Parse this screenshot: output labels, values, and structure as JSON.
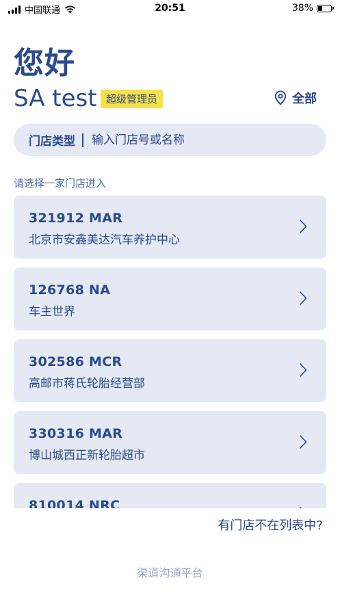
{
  "status_bar": {
    "carrier": "中国联通",
    "time": "20:51",
    "battery_text": "38%",
    "battery_level": 0.38
  },
  "greeting": "您好",
  "user": {
    "name": "SA test",
    "role": "超级管理员"
  },
  "location_filter": {
    "icon": "location-pin-icon",
    "label": "全部"
  },
  "search": {
    "type_label": "门店类型",
    "placeholder": "输入门店号或名称"
  },
  "hint": "请选择一家门店进入",
  "stores": [
    {
      "code": "321912 MAR",
      "name": "北京市安鑫美达汽车养护中心"
    },
    {
      "code": "126768 NA",
      "name": "车主世界"
    },
    {
      "code": "302586 MCR",
      "name": "高邮市蒋氏轮胎经营部"
    },
    {
      "code": "330316 MAR",
      "name": "博山城西正新轮胎超市"
    },
    {
      "code": "810014 NRC",
      "name": ""
    }
  ],
  "missing_store_link": "有门店不在列表中?",
  "footer": "渠道沟通平台",
  "colors": {
    "primary": "#2b4a8c",
    "card_bg": "#e4e9f3",
    "badge_bg": "#f7e04a",
    "footer_text": "#9aaac8"
  }
}
